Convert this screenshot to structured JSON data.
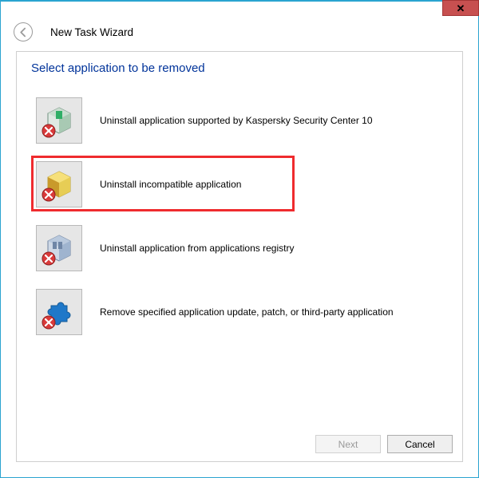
{
  "window": {
    "title": "New Task Wizard",
    "close_glyph": "✕"
  },
  "section": {
    "title": "Select application to be removed"
  },
  "options": [
    {
      "label": "Uninstall application supported by Kaspersky Security Center 10",
      "icon": "kaspersky-box-icon"
    },
    {
      "label": "Uninstall incompatible application",
      "icon": "yellow-box-icon"
    },
    {
      "label": "Uninstall application from applications registry",
      "icon": "registry-box-icon"
    },
    {
      "label": "Remove specified application update, patch, or third-party application",
      "icon": "puzzle-icon"
    }
  ],
  "highlighted_index": 1,
  "footer": {
    "next": "Next",
    "cancel": "Cancel"
  }
}
